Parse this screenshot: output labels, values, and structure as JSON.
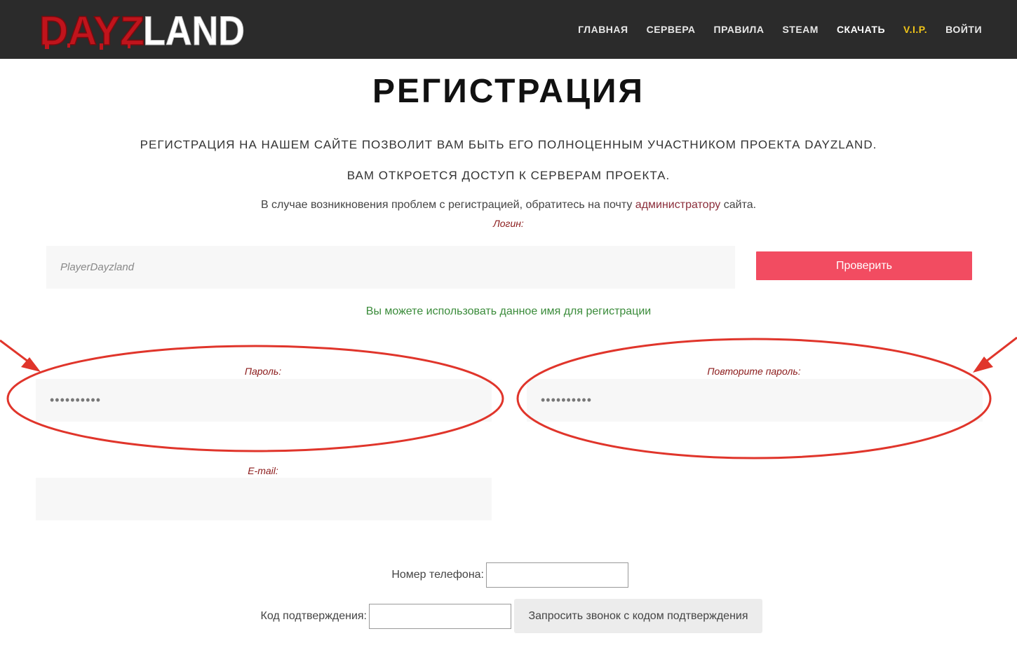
{
  "brand": {
    "logo_text": "DAYZLAND",
    "logo_red": "#c0141c"
  },
  "nav": {
    "items": [
      {
        "label": "ГЛАВНАЯ"
      },
      {
        "label": "СЕРВЕРА"
      },
      {
        "label": "ПРАВИЛА"
      },
      {
        "label": "STEAM"
      },
      {
        "label": "СКАЧАТЬ"
      },
      {
        "label": "V.I.P."
      },
      {
        "label": "ВОЙТИ"
      }
    ]
  },
  "page": {
    "title": "РЕГИСТРАЦИЯ",
    "intro_line1": "РЕГИСТРАЦИЯ НА НАШЕМ САЙТЕ ПОЗВОЛИТ ВАМ БЫТЬ ЕГО ПОЛНОЦЕННЫМ УЧАСТНИКОМ ПРОЕКТА DAYZLAND.",
    "intro_line2": "ВАМ ОТКРОЕТСЯ ДОСТУП К СЕРВЕРАМ ПРОЕКТА.",
    "help_before": "В случае возникновения проблем с регистрацией, обратитесь на почту ",
    "help_link": "администратору",
    "help_after": " сайта."
  },
  "form": {
    "login_label": "Логин:",
    "login_value": "PlayerDayzland",
    "check_button": "Проверить",
    "availability_message": "Вы можете использовать данное имя для регистрации",
    "password_label": "Пароль:",
    "password_value": "••••••••••",
    "repeat_password_label": "Повторите пароль:",
    "repeat_password_value": "••••••••••",
    "email_label": "E-mail:",
    "email_value": "",
    "phone_label": "Номер телефона:",
    "phone_value": "",
    "code_label": "Код подтверждения:",
    "code_value": "",
    "call_button": "Запросить звонок с кодом подтверждения"
  },
  "colors": {
    "topbar": "#2b2b2b",
    "accent_button": "#f24c61",
    "label_red": "#8b1a1a",
    "success_green": "#3a8b3a",
    "vip_yellow": "#f0c419",
    "annotation_red": "#e0352b"
  }
}
